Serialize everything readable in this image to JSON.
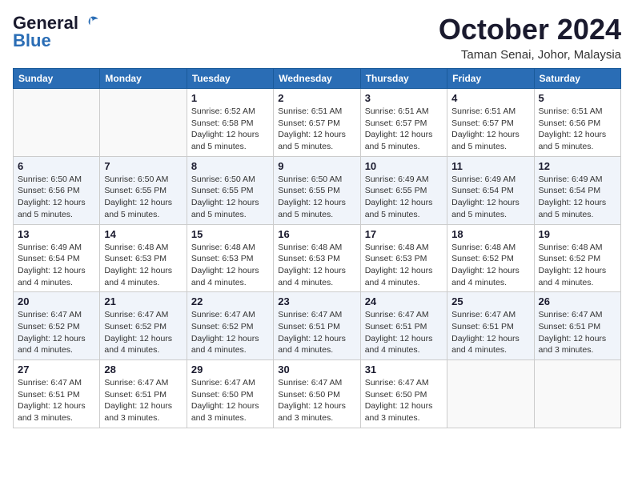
{
  "logo": {
    "general": "General",
    "blue": "Blue"
  },
  "title": "October 2024",
  "location": "Taman Senai, Johor, Malaysia",
  "days_of_week": [
    "Sunday",
    "Monday",
    "Tuesday",
    "Wednesday",
    "Thursday",
    "Friday",
    "Saturday"
  ],
  "weeks": [
    [
      {
        "day": "",
        "info": ""
      },
      {
        "day": "",
        "info": ""
      },
      {
        "day": "1",
        "info": "Sunrise: 6:52 AM\nSunset: 6:58 PM\nDaylight: 12 hours and 5 minutes."
      },
      {
        "day": "2",
        "info": "Sunrise: 6:51 AM\nSunset: 6:57 PM\nDaylight: 12 hours and 5 minutes."
      },
      {
        "day": "3",
        "info": "Sunrise: 6:51 AM\nSunset: 6:57 PM\nDaylight: 12 hours and 5 minutes."
      },
      {
        "day": "4",
        "info": "Sunrise: 6:51 AM\nSunset: 6:57 PM\nDaylight: 12 hours and 5 minutes."
      },
      {
        "day": "5",
        "info": "Sunrise: 6:51 AM\nSunset: 6:56 PM\nDaylight: 12 hours and 5 minutes."
      }
    ],
    [
      {
        "day": "6",
        "info": "Sunrise: 6:50 AM\nSunset: 6:56 PM\nDaylight: 12 hours and 5 minutes."
      },
      {
        "day": "7",
        "info": "Sunrise: 6:50 AM\nSunset: 6:55 PM\nDaylight: 12 hours and 5 minutes."
      },
      {
        "day": "8",
        "info": "Sunrise: 6:50 AM\nSunset: 6:55 PM\nDaylight: 12 hours and 5 minutes."
      },
      {
        "day": "9",
        "info": "Sunrise: 6:50 AM\nSunset: 6:55 PM\nDaylight: 12 hours and 5 minutes."
      },
      {
        "day": "10",
        "info": "Sunrise: 6:49 AM\nSunset: 6:55 PM\nDaylight: 12 hours and 5 minutes."
      },
      {
        "day": "11",
        "info": "Sunrise: 6:49 AM\nSunset: 6:54 PM\nDaylight: 12 hours and 5 minutes."
      },
      {
        "day": "12",
        "info": "Sunrise: 6:49 AM\nSunset: 6:54 PM\nDaylight: 12 hours and 5 minutes."
      }
    ],
    [
      {
        "day": "13",
        "info": "Sunrise: 6:49 AM\nSunset: 6:54 PM\nDaylight: 12 hours and 4 minutes."
      },
      {
        "day": "14",
        "info": "Sunrise: 6:48 AM\nSunset: 6:53 PM\nDaylight: 12 hours and 4 minutes."
      },
      {
        "day": "15",
        "info": "Sunrise: 6:48 AM\nSunset: 6:53 PM\nDaylight: 12 hours and 4 minutes."
      },
      {
        "day": "16",
        "info": "Sunrise: 6:48 AM\nSunset: 6:53 PM\nDaylight: 12 hours and 4 minutes."
      },
      {
        "day": "17",
        "info": "Sunrise: 6:48 AM\nSunset: 6:53 PM\nDaylight: 12 hours and 4 minutes."
      },
      {
        "day": "18",
        "info": "Sunrise: 6:48 AM\nSunset: 6:52 PM\nDaylight: 12 hours and 4 minutes."
      },
      {
        "day": "19",
        "info": "Sunrise: 6:48 AM\nSunset: 6:52 PM\nDaylight: 12 hours and 4 minutes."
      }
    ],
    [
      {
        "day": "20",
        "info": "Sunrise: 6:47 AM\nSunset: 6:52 PM\nDaylight: 12 hours and 4 minutes."
      },
      {
        "day": "21",
        "info": "Sunrise: 6:47 AM\nSunset: 6:52 PM\nDaylight: 12 hours and 4 minutes."
      },
      {
        "day": "22",
        "info": "Sunrise: 6:47 AM\nSunset: 6:52 PM\nDaylight: 12 hours and 4 minutes."
      },
      {
        "day": "23",
        "info": "Sunrise: 6:47 AM\nSunset: 6:51 PM\nDaylight: 12 hours and 4 minutes."
      },
      {
        "day": "24",
        "info": "Sunrise: 6:47 AM\nSunset: 6:51 PM\nDaylight: 12 hours and 4 minutes."
      },
      {
        "day": "25",
        "info": "Sunrise: 6:47 AM\nSunset: 6:51 PM\nDaylight: 12 hours and 4 minutes."
      },
      {
        "day": "26",
        "info": "Sunrise: 6:47 AM\nSunset: 6:51 PM\nDaylight: 12 hours and 3 minutes."
      }
    ],
    [
      {
        "day": "27",
        "info": "Sunrise: 6:47 AM\nSunset: 6:51 PM\nDaylight: 12 hours and 3 minutes."
      },
      {
        "day": "28",
        "info": "Sunrise: 6:47 AM\nSunset: 6:51 PM\nDaylight: 12 hours and 3 minutes."
      },
      {
        "day": "29",
        "info": "Sunrise: 6:47 AM\nSunset: 6:50 PM\nDaylight: 12 hours and 3 minutes."
      },
      {
        "day": "30",
        "info": "Sunrise: 6:47 AM\nSunset: 6:50 PM\nDaylight: 12 hours and 3 minutes."
      },
      {
        "day": "31",
        "info": "Sunrise: 6:47 AM\nSunset: 6:50 PM\nDaylight: 12 hours and 3 minutes."
      },
      {
        "day": "",
        "info": ""
      },
      {
        "day": "",
        "info": ""
      }
    ]
  ]
}
